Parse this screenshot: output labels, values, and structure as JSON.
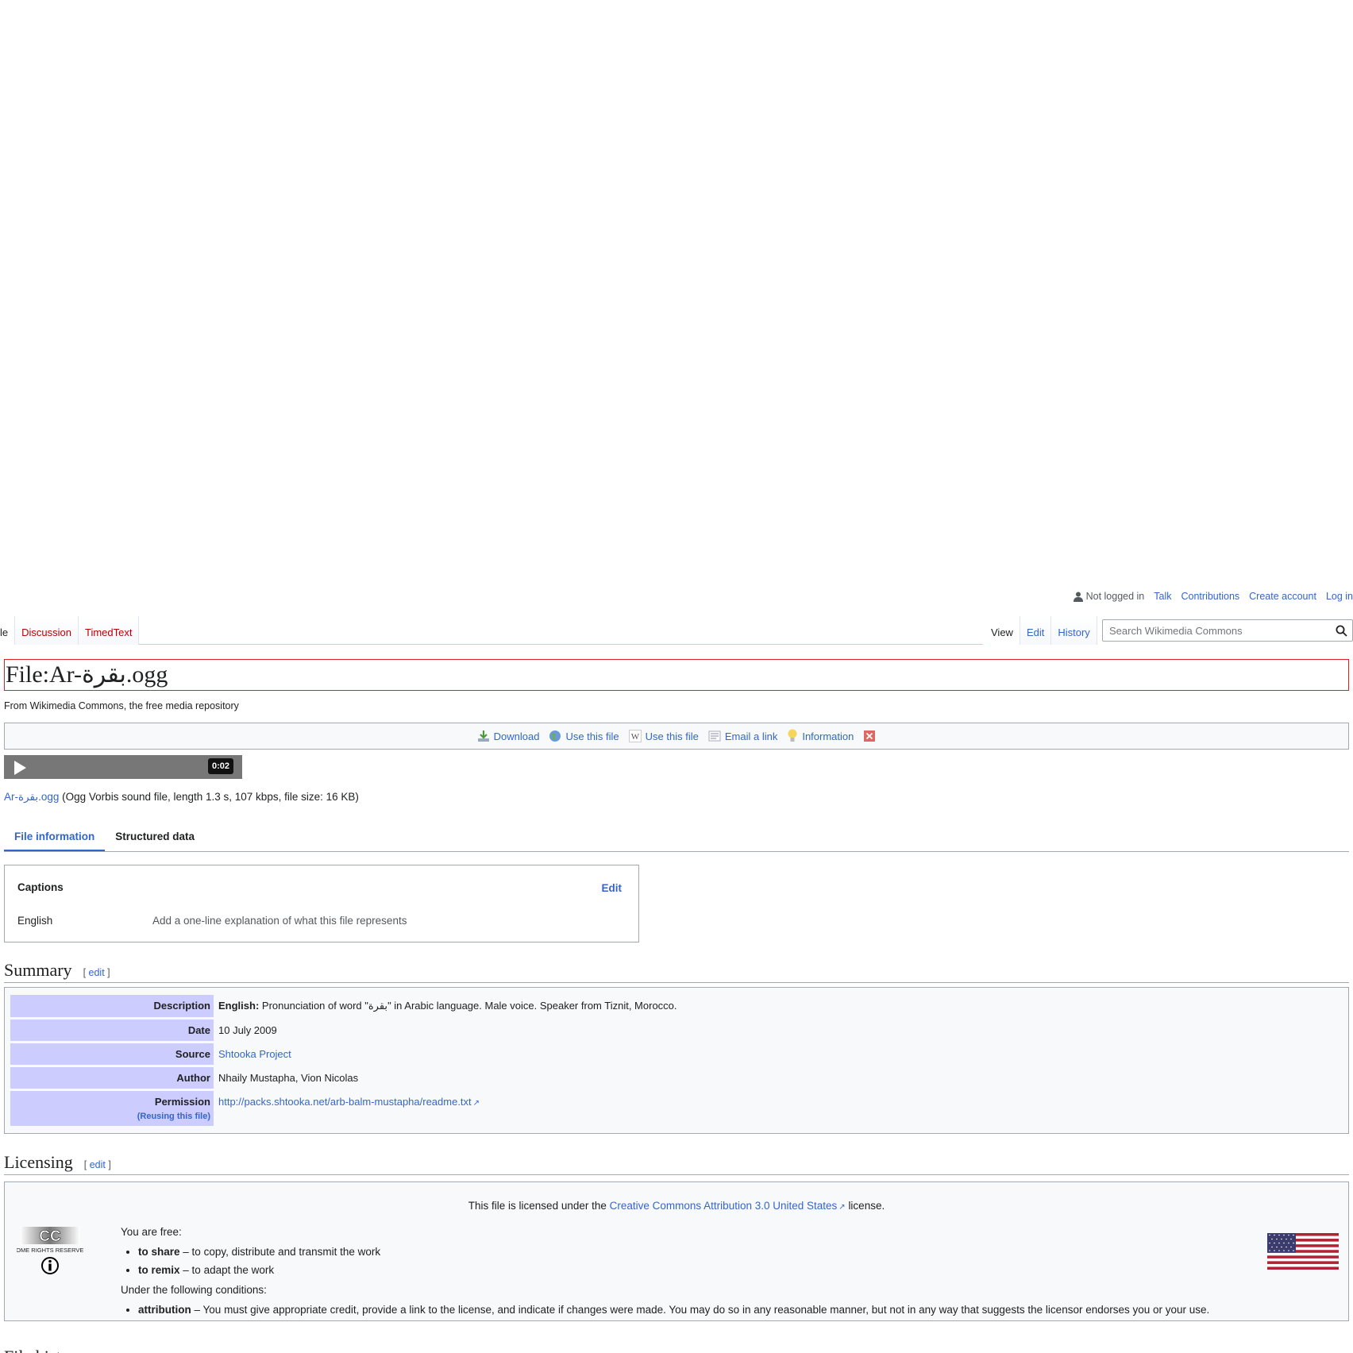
{
  "personal": {
    "not_logged_in": "Not logged in",
    "talk": "Talk",
    "contributions": "Contributions",
    "create_account": "Create account",
    "log_in": "Log in"
  },
  "tabs_left": [
    "le",
    "Discussion",
    "TimedText"
  ],
  "tabs_right": [
    "View",
    "Edit",
    "History"
  ],
  "search": {
    "placeholder": "Search Wikimedia Commons"
  },
  "title": "File:Ar-بقرة.ogg",
  "tagline": "From Wikimedia Commons, the free media repository",
  "actions": [
    "Download",
    "Use this file",
    "Use this file",
    "Email a link",
    "Information"
  ],
  "player": {
    "time": "0:02"
  },
  "file": {
    "link": "Ar-بقرة.ogg",
    "meta": "(Ogg Vorbis sound file, length 1.3 s, 107 kbps, file size: 16 KB)"
  },
  "file_tabs": [
    "File information",
    "Structured data"
  ],
  "captions": {
    "heading": "Captions",
    "edit": "Edit",
    "language": "English",
    "placeholder": "Add a one-line explanation of what this file represents"
  },
  "summary": {
    "heading": "Summary",
    "edit": "edit",
    "rows": {
      "description_label": "Description",
      "description_lang": "English:",
      "description_text": "Pronunciation of word \"بقرة\" in Arabic language. Male voice. Speaker from Tiznit, Morocco.",
      "date_label": "Date",
      "date": "10 July 2009",
      "source_label": "Source",
      "source": "Shtooka Project",
      "author_label": "Author",
      "author": "Nhaily Mustapha, Vion Nicolas",
      "permission_label": "Permission",
      "reusing": "(Reusing this file)",
      "permission": "http://packs.shtooka.net/arb-balm-mustapha/readme.txt"
    }
  },
  "licensing": {
    "heading": "Licensing",
    "edit": "edit",
    "intro_pre": "This file is licensed under the",
    "license_link": "Creative Commons Attribution 3.0 United States",
    "intro_post": "license.",
    "you_are_free": "You are free:",
    "share_bold": "to share",
    "share_text": "– to copy, distribute and transmit the work",
    "remix_bold": "to remix",
    "remix_text": "– to adapt the work",
    "conditions": "Under the following conditions:",
    "attr_bold": "attribution",
    "attr_text": "– You must give appropriate credit, provide a link to the license, and indicate if changes were made. You may do so in any reasonable manner, but not in any way that suggests the licensor endorses you or your use.",
    "cc_logo_text": "SOME RIGHTS RESERVED"
  },
  "next_heading": "File history"
}
